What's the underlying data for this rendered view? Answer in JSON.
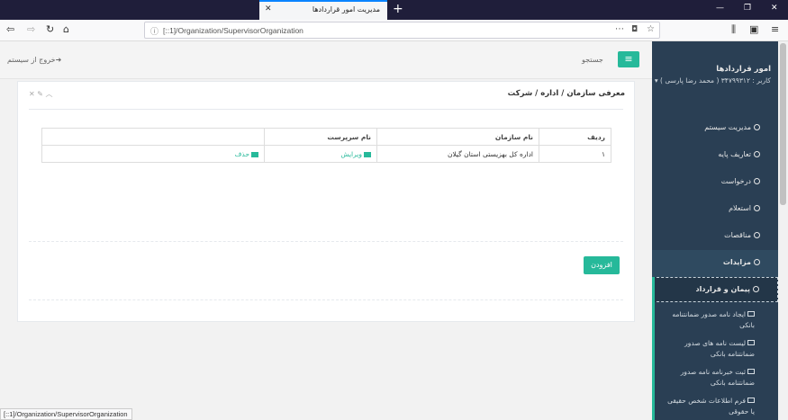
{
  "browser": {
    "tab_title": "مدیریت امور قراردادها",
    "url": "[::1]/Organization/SupervisorOrganization",
    "status_url": "[::1]/Organization/SupervisorOrganization"
  },
  "header": {
    "search": "جستجو",
    "exit": "خروج از سیستم"
  },
  "panel": {
    "title": "معرفی سازمان / اداره / شرکت",
    "add": "افزودن"
  },
  "table": {
    "headers": [
      "ردیف",
      "نام سازمان",
      "نام سرپرست",
      ""
    ],
    "rows": [
      {
        "index": "۱",
        "org": "اداره کل بهزیستی استان گیلان",
        "supervisor": "",
        "edit": "ویرایش",
        "delete": "حذف"
      }
    ]
  },
  "sidebar": {
    "title": "امور قراردادها",
    "user": "کاربر : ۳۴۷۹۹۳۱۲ ( محمد رضا پارسی ) ▾",
    "items": [
      "مدیریت سیستم",
      "تعاریف پایه",
      "درخواست",
      "استعلام",
      "مناقصات",
      "مزایدات",
      "پیمان و قرارداد"
    ],
    "subitems": [
      "ایجاد نامه صدور ضمانتنامه بانکی",
      "لیست نامه های صدور ضمانتنامه بانکی",
      "ثبت خبرنامه نامه صدور ضمانتنامه بانکی",
      "فرم اطلاعات شخص حقیقی یا حقوقی"
    ]
  }
}
